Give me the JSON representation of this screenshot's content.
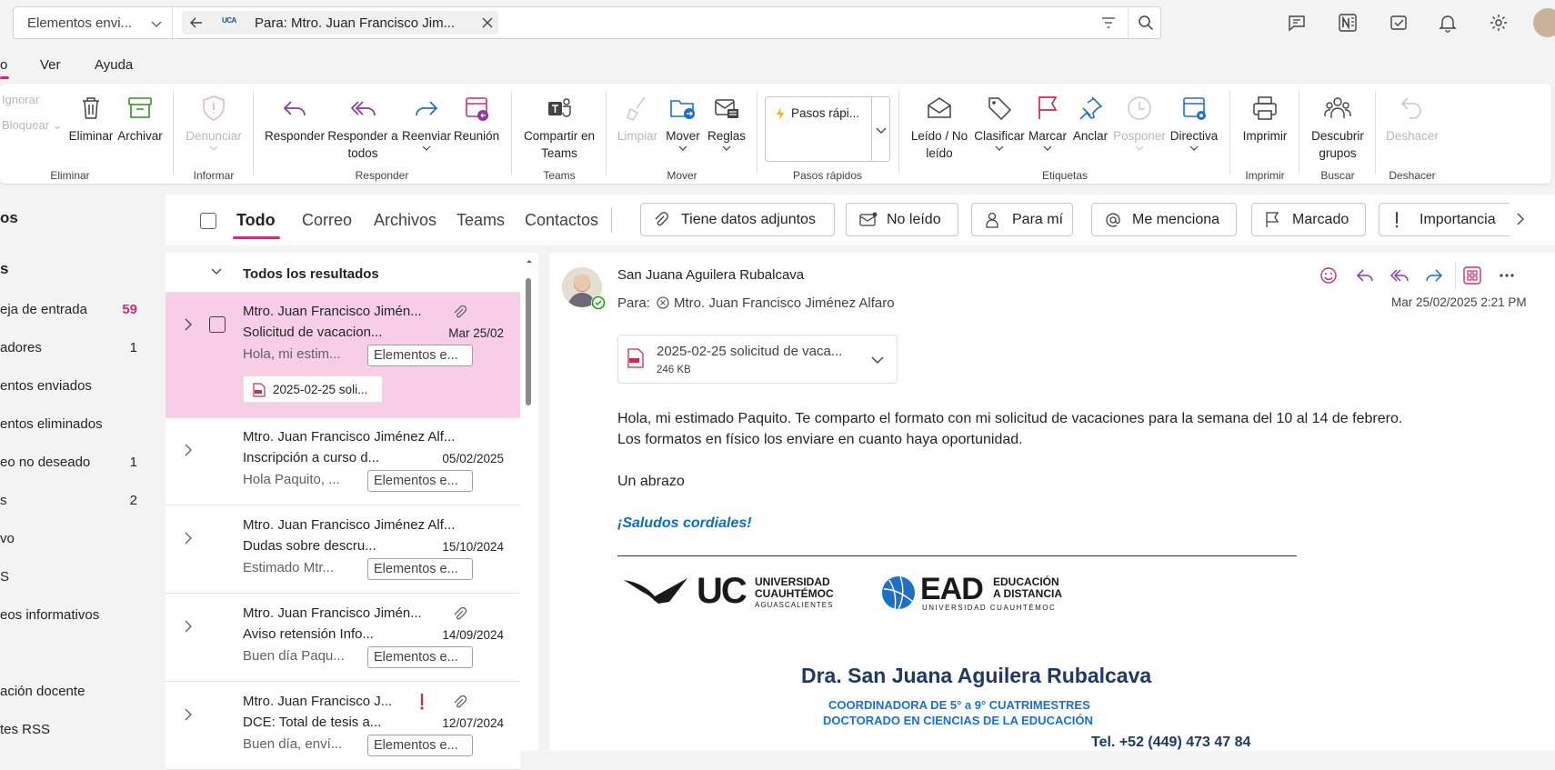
{
  "topbar": {
    "folder": "Elementos envi...",
    "search_chip": "Para: Mtro. Juan Francisco Jim...",
    "chip_logo": "UCA"
  },
  "ribbon_tabs": [
    "o",
    "Ver",
    "Ayuda"
  ],
  "ribbon": {
    "ignorar": "Ignorar",
    "bloquear": "Bloquear",
    "eliminar": "Eliminar",
    "archivar": "Archivar",
    "denunciar": "Denunciar",
    "responder": "Responder",
    "responder_todos_1": "Responder a",
    "responder_todos_2": "todos",
    "reenviar": "Reenviar",
    "reunion": "Reunión",
    "teams_1": "Compartir en",
    "teams_2": "Teams",
    "limpiar": "Limpiar",
    "mover": "Mover",
    "reglas": "Reglas",
    "pasos_rapidos": "Pasos rápi...",
    "leido_1": "Leído / No",
    "leido_2": "leído",
    "clasificar": "Clasificar",
    "marcar": "Marcar",
    "anclar": "Anclar",
    "posponer": "Posponer",
    "directiva": "Directiva",
    "imprimir": "Imprimir",
    "descubrir_1": "Descubrir",
    "descubrir_2": "grupos",
    "deshacer": "Deshacer",
    "groups": {
      "eliminar": "Eliminar",
      "informar": "Informar",
      "responder": "Responder",
      "teams": "Teams",
      "mover": "Mover",
      "pasos": "Pasos rápidos",
      "etiquetas": "Etiquetas",
      "imprimir": "Imprimir",
      "buscar": "Buscar",
      "deshacer": "Deshacer"
    }
  },
  "leftnav": {
    "header1": "os",
    "header2": "s",
    "items": [
      {
        "label": "eja de entrada",
        "count": "59"
      },
      {
        "label": "adores",
        "count": "1"
      },
      {
        "label": "entos enviados",
        "count": ""
      },
      {
        "label": "entos eliminados",
        "count": ""
      },
      {
        "label": "eo no deseado",
        "count": "1"
      },
      {
        "label": "s",
        "count": "2"
      },
      {
        "label": "vo",
        "count": ""
      },
      {
        "label": "S",
        "count": ""
      },
      {
        "label": "eos informativos",
        "count": ""
      },
      {
        "label": "ación docente",
        "count": ""
      },
      {
        "label": "tes RSS",
        "count": ""
      }
    ]
  },
  "filterbar": {
    "tabs": [
      "Todo",
      "Correo",
      "Archivos",
      "Teams",
      "Contactos"
    ],
    "chips": [
      "Tiene datos adjuntos",
      "No leído",
      "Para mí",
      "Me menciona",
      "Marcado",
      "Importancia"
    ]
  },
  "list": {
    "header": "Todos los resultados",
    "messages": [
      {
        "from": "Mtro. Juan Francisco Jimén...",
        "subject": "Solicitud de vacacion...",
        "date": "Mar 25/02",
        "preview": "Hola, mi estim...",
        "tag": "Elementos e...",
        "attachment": "2025-02-25 soli..."
      },
      {
        "from": "Mtro. Juan Francisco Jiménez Alf...",
        "subject": "Inscripción a curso d...",
        "date": "05/02/2025",
        "preview": "Hola Paquito, ...",
        "tag": "Elementos e..."
      },
      {
        "from": "Mtro. Juan Francisco Jiménez Alf...",
        "subject": "Dudas sobre descru...",
        "date": "15/10/2024",
        "preview": "Estimado Mtr...",
        "tag": "Elementos e..."
      },
      {
        "from": "Mtro. Juan Francisco Jimén...",
        "subject": "Aviso retensión Info...",
        "date": "14/09/2024",
        "preview": "Buen día Paqu...",
        "tag": "Elementos e..."
      },
      {
        "from": "Mtro. Juan Francisco J...",
        "subject": "DCE: Total de tesis a...",
        "date": "12/07/2024",
        "preview": "Buen día, enví...",
        "tag": "Elementos e..."
      }
    ]
  },
  "reading": {
    "sender": "San Juana Aguilera Rubalcava",
    "to_label": "Para:",
    "to": "Mtro. Juan Francisco Jiménez Alfaro",
    "datetime": "Mar 25/02/2025 2:21 PM",
    "attachment_name": "2025-02-25 solicitud de vaca...",
    "attachment_size": "246 KB",
    "body_1": "Hola, mi estimado Paquito. Te comparto el formato con mi solicitud de vacaciones para la semana del 10 al 14 de febrero.",
    "body_2": "Los formatos en físico los enviare en cuanto haya oportunidad.",
    "body_3": "Un abrazo",
    "saludos": "¡Saludos cordiales!",
    "logo_uc": "UC",
    "logo_uc_1": "UNIVERSIDAD",
    "logo_uc_2": "CUAUHTÉMOC",
    "logo_uc_3": "AGUASCALIENTES",
    "logo_ead": "EAD",
    "logo_ead_1": "EDUCACIÓN",
    "logo_ead_2": "A DISTANCIA",
    "logo_ead_3": "UNIVERSIDAD CUAUHTÉMOC",
    "sig_name": "Dra. San Juana Aguilera Rubalcava",
    "sig_role_pre": "COORDINADORA DE ",
    "sig_role_bold": "5° a 9° CUATRIMESTRES",
    "sig_program": "DOCTORADO EN CIENCIAS DE LA EDUCACIÓN",
    "sig_tel_label": "Tel.",
    "sig_tel": "+52 (449) 473 47 84"
  },
  "colors": {
    "accent": "#c4307a",
    "selected": "#f7cde8",
    "link_blue": "#0f6cbd",
    "purple": "#8b3a9f"
  }
}
